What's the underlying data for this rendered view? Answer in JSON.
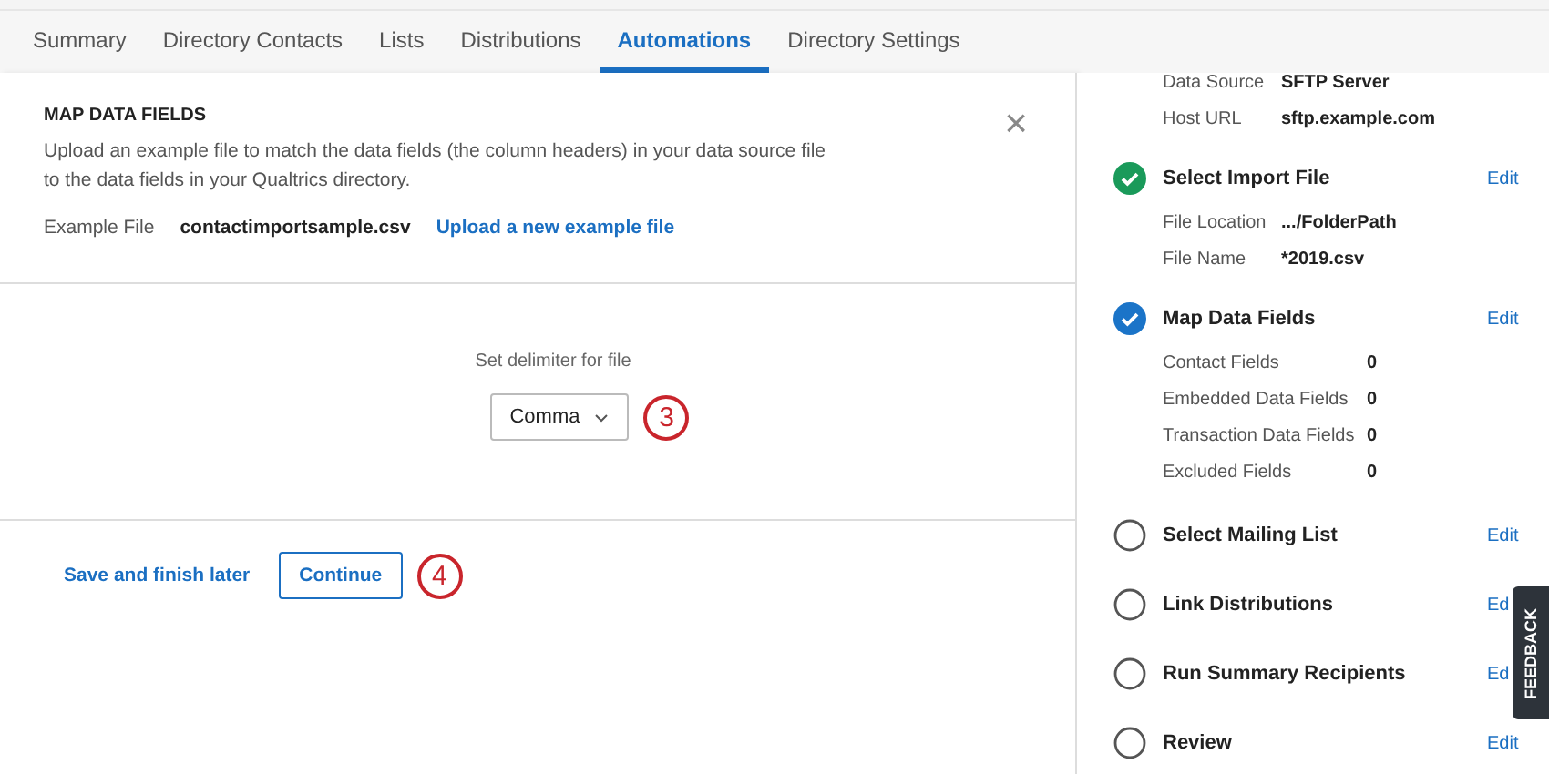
{
  "tabs": [
    {
      "label": "Summary",
      "selected": false
    },
    {
      "label": "Directory Contacts",
      "selected": false
    },
    {
      "label": "Lists",
      "selected": false
    },
    {
      "label": "Distributions",
      "selected": false
    },
    {
      "label": "Automations",
      "selected": true
    },
    {
      "label": "Directory Settings",
      "selected": false
    }
  ],
  "panel": {
    "title": "MAP DATA FIELDS",
    "close": "×",
    "description": "Upload an example file to match the data fields (the column headers) in your data source file to the data fields in your Qualtrics directory.",
    "example_label": "Example File",
    "example_value": "contactimportsample.csv",
    "upload_link": "Upload a new example file",
    "delimiter_label": "Set delimiter for file",
    "delimiter_value": "Comma",
    "delimiter_callout": "3",
    "save_link": "Save and finish later",
    "continue_button": "Continue",
    "continue_callout": "4"
  },
  "sidebar": {
    "top_details": [
      {
        "label": "Data Source",
        "value": "SFTP Server"
      },
      {
        "label": "Host URL",
        "value": "sftp.example.com"
      }
    ],
    "steps": [
      {
        "title": "Select Import File",
        "kind": "done",
        "edit": "Edit",
        "details": [
          {
            "label": "File Location",
            "value": ".../FolderPath"
          },
          {
            "label": "File Name",
            "value": "*2019.csv"
          }
        ]
      },
      {
        "title": "Map Data Fields",
        "kind": "current",
        "edit": "Edit",
        "details": [
          {
            "label": "Contact Fields",
            "value": "0"
          },
          {
            "label": "Embedded Data Fields",
            "value": "0"
          },
          {
            "label": "Transaction Data Fields",
            "value": "0"
          },
          {
            "label": "Excluded Fields",
            "value": "0"
          }
        ]
      },
      {
        "title": "Select Mailing List",
        "kind": "pending",
        "edit": "Edit"
      },
      {
        "title": "Link Distributions",
        "kind": "pending",
        "edit": "Ed"
      },
      {
        "title": "Run Summary Recipients",
        "kind": "pending",
        "edit": "Ed"
      },
      {
        "title": "Review",
        "kind": "pending",
        "edit": "Edit"
      }
    ]
  },
  "feedback_tab": "FEEDBACK"
}
